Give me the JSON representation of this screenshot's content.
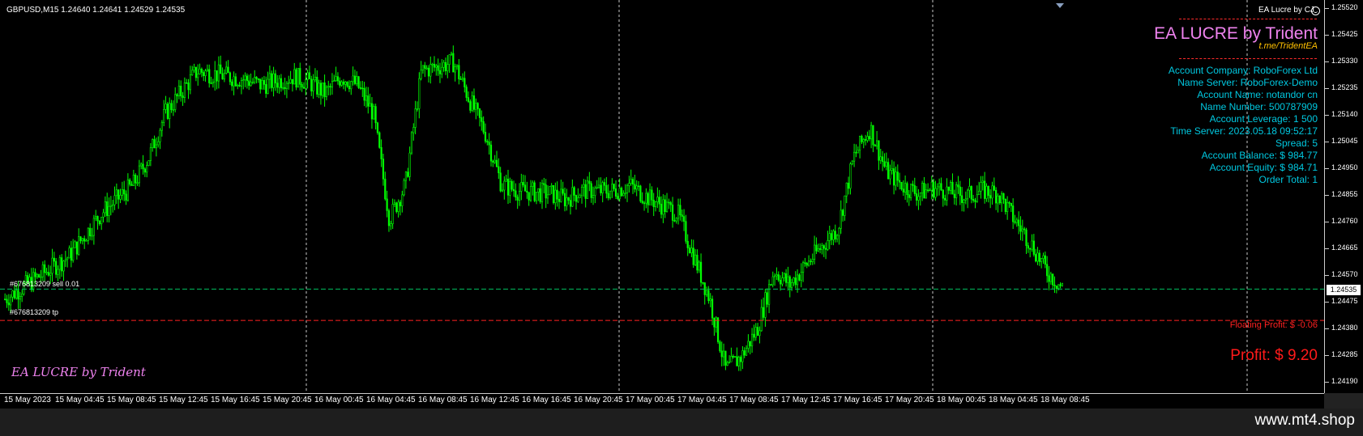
{
  "symbol_info": "GBPUSD,M15  1.24640 1.24641 1.24529 1.24535",
  "ea_tag": "EA Lucre by CJ",
  "panel": {
    "title": "EA LUCRE by Trident",
    "link": "t.me/TridentEA",
    "info": [
      "Account Company: RoboForex Ltd",
      "Name Server: RoboForex-Demo",
      "Account Name: notandor cn",
      "Name Number: 500787909",
      "Account Leverage: 1 500",
      "Time Server: 2023.05.18 09:52:17",
      "Spread: 5",
      "Account Balance: $ 984.77",
      "Account Equity: $ 984.71",
      "Order Total: 1"
    ],
    "floating_profit": "Floating Profit: $ -0.06",
    "profit": "Profit: $ 9.20"
  },
  "orders": {
    "sell": "#676813209 sell 0.01",
    "tp": "#676813209 tp"
  },
  "watermark": "EA LUCRE by Trident",
  "price_labels": [
    "1.25520",
    "1.25425",
    "1.25330",
    "1.25235",
    "1.25140",
    "1.25045",
    "1.24950",
    "1.24855",
    "1.24760",
    "1.24665",
    "1.24570",
    "1.24475",
    "1.24380",
    "1.24285",
    "1.24190"
  ],
  "current_price": "1.24535",
  "time_labels": [
    "15 May 2023",
    "15 May 04:45",
    "15 May 08:45",
    "15 May 12:45",
    "15 May 16:45",
    "15 May 20:45",
    "16 May 00:45",
    "16 May 04:45",
    "16 May 08:45",
    "16 May 12:45",
    "16 May 16:45",
    "16 May 20:45",
    "17 May 00:45",
    "17 May 04:45",
    "17 May 08:45",
    "17 May 12:45",
    "17 May 16:45",
    "17 May 20:45",
    "18 May 00:45",
    "18 May 04:45",
    "18 May 08:45"
  ],
  "site": "www.mt4.shop",
  "colors": {
    "candle": "#00ff00",
    "sell_line": "#00c060",
    "tp_line": "#ff2020",
    "info_text": "#00c8e0",
    "title": "#ee82ee"
  },
  "chart_data": {
    "type": "candlestick",
    "symbol": "GBPUSD",
    "timeframe": "M15",
    "ylim": [
      1.2419,
      1.2552
    ],
    "close_path": [
      [
        0,
        1.245
      ],
      [
        2,
        1.2465
      ],
      [
        3,
        1.248
      ],
      [
        4,
        1.249
      ],
      [
        4.5,
        1.25
      ],
      [
        5,
        1.2515
      ],
      [
        6,
        1.253
      ],
      [
        7,
        1.2528
      ],
      [
        7.5,
        1.2527
      ],
      [
        8,
        1.2525
      ],
      [
        9,
        1.2528
      ],
      [
        9.5,
        1.2526
      ],
      [
        10,
        1.2522
      ],
      [
        10.5,
        1.2528
      ],
      [
        11,
        1.2525
      ],
      [
        11.5,
        1.2515
      ],
      [
        12,
        1.2478
      ],
      [
        12.5,
        1.249
      ],
      [
        13,
        1.253
      ],
      [
        14,
        1.2533
      ],
      [
        14.5,
        1.252
      ],
      [
        15,
        1.2508
      ],
      [
        15.5,
        1.249
      ],
      [
        16,
        1.2488
      ],
      [
        17,
        1.2487
      ],
      [
        17.5,
        1.2485
      ],
      [
        18,
        1.2488
      ],
      [
        19,
        1.2488
      ],
      [
        19.5,
        1.249
      ],
      [
        20,
        1.2486
      ],
      [
        21,
        1.248
      ],
      [
        21.5,
        1.2465
      ],
      [
        22,
        1.245
      ],
      [
        22.5,
        1.2425
      ],
      [
        23,
        1.243
      ],
      [
        23.5,
        1.244
      ],
      [
        24,
        1.246
      ],
      [
        24.5,
        1.2455
      ],
      [
        25,
        1.2462
      ],
      [
        26,
        1.2475
      ],
      [
        26.5,
        1.25
      ],
      [
        27,
        1.251
      ],
      [
        27.5,
        1.2495
      ],
      [
        28,
        1.249
      ],
      [
        28.5,
        1.2487
      ],
      [
        29,
        1.2489
      ],
      [
        30,
        1.2486
      ],
      [
        30.5,
        1.2488
      ],
      [
        31,
        1.2487
      ],
      [
        31.5,
        1.2478
      ],
      [
        32,
        1.247
      ],
      [
        32.5,
        1.246
      ],
      [
        33,
        1.2454
      ]
    ]
  }
}
